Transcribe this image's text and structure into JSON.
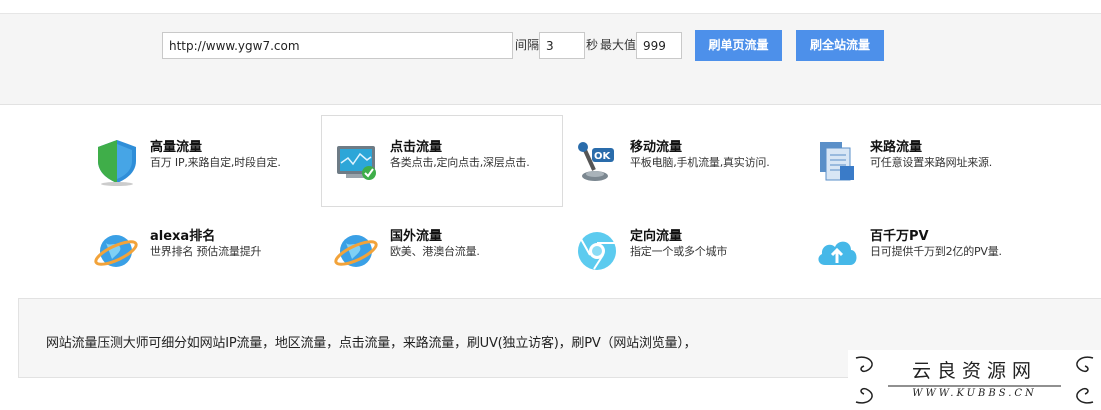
{
  "toolbar": {
    "url_value": "http://www.ygw7.com",
    "interval_label": "间隔",
    "interval_value": "3",
    "seconds_label": "秒",
    "max_label": "最大值",
    "max_value": "999",
    "single_page_button": "刷单页流量",
    "whole_site_button": "刷全站流量"
  },
  "features": [
    {
      "title": "高量流量",
      "desc": "百万 IP,来路自定,时段自定.",
      "icon": "shield-icon"
    },
    {
      "title": "点击流量",
      "desc": "各类点击,定向点击,深层点击.",
      "icon": "monitor-check-icon"
    },
    {
      "title": "移动流量",
      "desc": "平板电脑,手机流量,真实访问.",
      "icon": "joystick-icon"
    },
    {
      "title": "来路流量",
      "desc": "可任意设置来路网址来源.",
      "icon": "documents-icon"
    },
    {
      "title": "alexa排名",
      "desc": "世界排名 预估流量提升",
      "icon": "globe-icon"
    },
    {
      "title": "国外流量",
      "desc": "欧美、港澳台流量.",
      "icon": "globe-icon"
    },
    {
      "title": "定向流量",
      "desc": "指定一个或多个城市",
      "icon": "chrome-icon"
    },
    {
      "title": "百千万PV",
      "desc": "日可提供千万到2亿的PV量.",
      "icon": "cloud-upload-icon"
    }
  ],
  "info": {
    "text": "网站流量压测大师可细分如网站IP流量，地区流量，点击流量，来路流量，刷UV(独立访客)，刷PV（网站浏览量），"
  },
  "watermark": {
    "name": "云良资源网",
    "url": "WWW.KUBBS.CN"
  },
  "colors": {
    "button": "#4d90ea",
    "band": "#f5f5f5"
  }
}
